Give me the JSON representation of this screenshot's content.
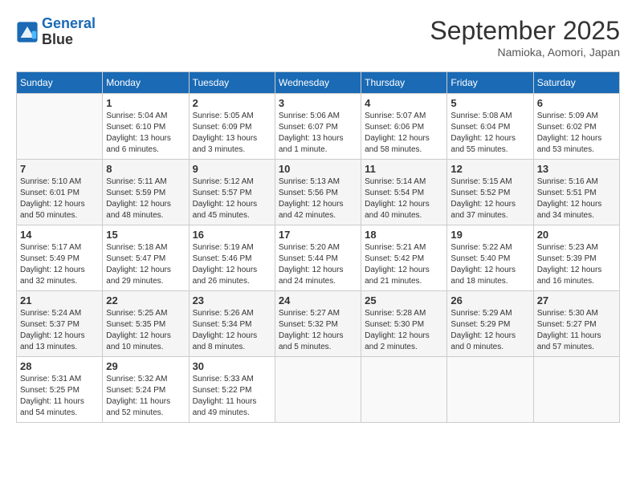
{
  "header": {
    "logo_line1": "General",
    "logo_line2": "Blue",
    "month": "September 2025",
    "location": "Namioka, Aomori, Japan"
  },
  "days_of_week": [
    "Sunday",
    "Monday",
    "Tuesday",
    "Wednesday",
    "Thursday",
    "Friday",
    "Saturday"
  ],
  "weeks": [
    [
      {
        "day": "",
        "info": ""
      },
      {
        "day": "1",
        "info": "Sunrise: 5:04 AM\nSunset: 6:10 PM\nDaylight: 13 hours\nand 6 minutes."
      },
      {
        "day": "2",
        "info": "Sunrise: 5:05 AM\nSunset: 6:09 PM\nDaylight: 13 hours\nand 3 minutes."
      },
      {
        "day": "3",
        "info": "Sunrise: 5:06 AM\nSunset: 6:07 PM\nDaylight: 13 hours\nand 1 minute."
      },
      {
        "day": "4",
        "info": "Sunrise: 5:07 AM\nSunset: 6:06 PM\nDaylight: 12 hours\nand 58 minutes."
      },
      {
        "day": "5",
        "info": "Sunrise: 5:08 AM\nSunset: 6:04 PM\nDaylight: 12 hours\nand 55 minutes."
      },
      {
        "day": "6",
        "info": "Sunrise: 5:09 AM\nSunset: 6:02 PM\nDaylight: 12 hours\nand 53 minutes."
      }
    ],
    [
      {
        "day": "7",
        "info": "Sunrise: 5:10 AM\nSunset: 6:01 PM\nDaylight: 12 hours\nand 50 minutes."
      },
      {
        "day": "8",
        "info": "Sunrise: 5:11 AM\nSunset: 5:59 PM\nDaylight: 12 hours\nand 48 minutes."
      },
      {
        "day": "9",
        "info": "Sunrise: 5:12 AM\nSunset: 5:57 PM\nDaylight: 12 hours\nand 45 minutes."
      },
      {
        "day": "10",
        "info": "Sunrise: 5:13 AM\nSunset: 5:56 PM\nDaylight: 12 hours\nand 42 minutes."
      },
      {
        "day": "11",
        "info": "Sunrise: 5:14 AM\nSunset: 5:54 PM\nDaylight: 12 hours\nand 40 minutes."
      },
      {
        "day": "12",
        "info": "Sunrise: 5:15 AM\nSunset: 5:52 PM\nDaylight: 12 hours\nand 37 minutes."
      },
      {
        "day": "13",
        "info": "Sunrise: 5:16 AM\nSunset: 5:51 PM\nDaylight: 12 hours\nand 34 minutes."
      }
    ],
    [
      {
        "day": "14",
        "info": "Sunrise: 5:17 AM\nSunset: 5:49 PM\nDaylight: 12 hours\nand 32 minutes."
      },
      {
        "day": "15",
        "info": "Sunrise: 5:18 AM\nSunset: 5:47 PM\nDaylight: 12 hours\nand 29 minutes."
      },
      {
        "day": "16",
        "info": "Sunrise: 5:19 AM\nSunset: 5:46 PM\nDaylight: 12 hours\nand 26 minutes."
      },
      {
        "day": "17",
        "info": "Sunrise: 5:20 AM\nSunset: 5:44 PM\nDaylight: 12 hours\nand 24 minutes."
      },
      {
        "day": "18",
        "info": "Sunrise: 5:21 AM\nSunset: 5:42 PM\nDaylight: 12 hours\nand 21 minutes."
      },
      {
        "day": "19",
        "info": "Sunrise: 5:22 AM\nSunset: 5:40 PM\nDaylight: 12 hours\nand 18 minutes."
      },
      {
        "day": "20",
        "info": "Sunrise: 5:23 AM\nSunset: 5:39 PM\nDaylight: 12 hours\nand 16 minutes."
      }
    ],
    [
      {
        "day": "21",
        "info": "Sunrise: 5:24 AM\nSunset: 5:37 PM\nDaylight: 12 hours\nand 13 minutes."
      },
      {
        "day": "22",
        "info": "Sunrise: 5:25 AM\nSunset: 5:35 PM\nDaylight: 12 hours\nand 10 minutes."
      },
      {
        "day": "23",
        "info": "Sunrise: 5:26 AM\nSunset: 5:34 PM\nDaylight: 12 hours\nand 8 minutes."
      },
      {
        "day": "24",
        "info": "Sunrise: 5:27 AM\nSunset: 5:32 PM\nDaylight: 12 hours\nand 5 minutes."
      },
      {
        "day": "25",
        "info": "Sunrise: 5:28 AM\nSunset: 5:30 PM\nDaylight: 12 hours\nand 2 minutes."
      },
      {
        "day": "26",
        "info": "Sunrise: 5:29 AM\nSunset: 5:29 PM\nDaylight: 12 hours\nand 0 minutes."
      },
      {
        "day": "27",
        "info": "Sunrise: 5:30 AM\nSunset: 5:27 PM\nDaylight: 11 hours\nand 57 minutes."
      }
    ],
    [
      {
        "day": "28",
        "info": "Sunrise: 5:31 AM\nSunset: 5:25 PM\nDaylight: 11 hours\nand 54 minutes."
      },
      {
        "day": "29",
        "info": "Sunrise: 5:32 AM\nSunset: 5:24 PM\nDaylight: 11 hours\nand 52 minutes."
      },
      {
        "day": "30",
        "info": "Sunrise: 5:33 AM\nSunset: 5:22 PM\nDaylight: 11 hours\nand 49 minutes."
      },
      {
        "day": "",
        "info": ""
      },
      {
        "day": "",
        "info": ""
      },
      {
        "day": "",
        "info": ""
      },
      {
        "day": "",
        "info": ""
      }
    ]
  ]
}
